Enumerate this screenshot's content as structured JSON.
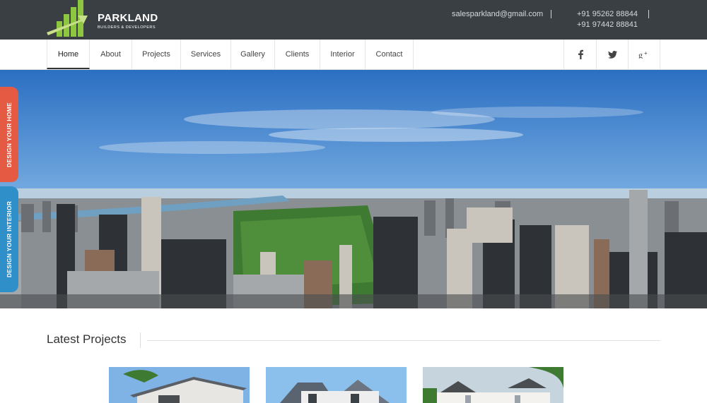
{
  "brand": {
    "name": "PARKLAND",
    "tagline": "BUILDERS & DEVELOPERS",
    "accent": "#8dc63f"
  },
  "contact": {
    "email": "salesparkland@gmail.com",
    "phone1": "+91 95262 88844",
    "phone2": "+91 97442 88841"
  },
  "nav": {
    "items": [
      {
        "label": "Home",
        "active": true
      },
      {
        "label": "About"
      },
      {
        "label": "Projects"
      },
      {
        "label": "Services"
      },
      {
        "label": "Gallery"
      },
      {
        "label": "Clients"
      },
      {
        "label": "Interior"
      },
      {
        "label": "Contact"
      }
    ],
    "social": [
      "facebook-icon",
      "twitter-icon",
      "google-plus-icon"
    ]
  },
  "side_tabs": {
    "home": "DESIGN YOUR HOME",
    "interior": "DESIGN YOUR INTERIOR"
  },
  "section": {
    "title": "Latest Projects"
  },
  "colors": {
    "topbar": "#3a3f44",
    "tab_home": "#e55a43",
    "tab_interior": "#2f8fc9"
  }
}
